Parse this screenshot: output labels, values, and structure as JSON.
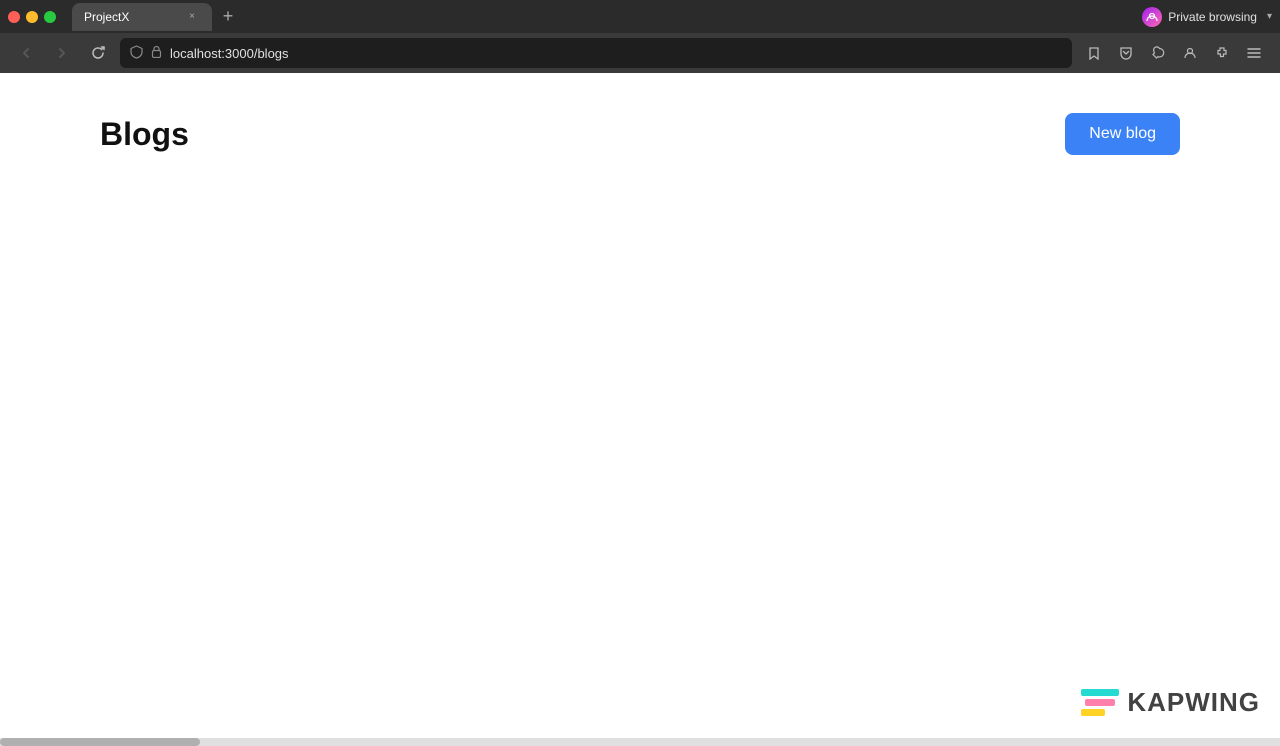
{
  "browser": {
    "title_bar": {
      "tab_title": "ProjectX",
      "close_label": "×",
      "new_tab_label": "+",
      "private_browsing_label": "Private browsing",
      "dropdown_arrow": "▾"
    },
    "nav": {
      "back_label": "←",
      "forward_label": "→",
      "reload_label": "↻",
      "address": "localhost:3000/blogs",
      "bookmark_label": "☆",
      "pocket_label": "📥",
      "tools_label": "🔧",
      "profile_label": "👤",
      "extensions_label": "🧩",
      "menu_label": "≡"
    }
  },
  "page": {
    "title": "Blogs",
    "new_blog_button": "New blog"
  },
  "watermark": {
    "text": "KAPWING"
  }
}
